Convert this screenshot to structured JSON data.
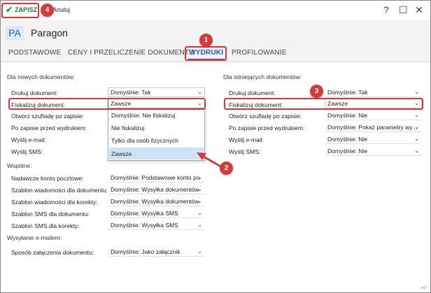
{
  "toolbar": {
    "save_label": "ZAPISZ",
    "cancel_label": "Anuluj"
  },
  "window_controls": {
    "help": "?",
    "maximize": "☐",
    "close": "✕"
  },
  "header": {
    "badge": "PA",
    "title": "Paragon"
  },
  "tabs": [
    {
      "label": "PODSTAWOWE"
    },
    {
      "label": "CENY I PRZELICZENIE DOKUMENTU"
    },
    {
      "label": "WYDRUKI"
    },
    {
      "label": "PROFILOWANIE"
    }
  ],
  "new_docs": {
    "heading": "Dla nowych dokumentów:",
    "rows": [
      {
        "label": "Drukuj dokument:",
        "value": "Domyślnie: Tak"
      },
      {
        "label": "Fiskalizuj dokument:",
        "value": "Zawsze"
      },
      {
        "label": "Otwórz szufladę po zapisie:",
        "value": ""
      },
      {
        "label": "Po zapisie przed wydrukiem:",
        "value": ""
      },
      {
        "label": "Wyślij e-mail:",
        "value": ""
      },
      {
        "label": "Wyślij SMS:",
        "value": ""
      }
    ],
    "dropdown_options": [
      "Domyślnie: Nie fiskalizuj",
      "Nie fiskalizuj",
      "Tylko dla osób fizycznych",
      "Zawsze"
    ]
  },
  "existing_docs": {
    "heading": "Dla istniejących dokumentów:",
    "rows": [
      {
        "label": "Drukuj dokument:",
        "value": "Domyślnie: Tak"
      },
      {
        "label": "Fiskalizuj dokument:",
        "value": "Zawsze"
      },
      {
        "label": "Otwórz szufladę po zapisie:",
        "value": "Domyślnie: Nie"
      },
      {
        "label": "Po zapisie przed wydrukiem:",
        "value": "Domyślnie: Pokaż parametry wy..."
      },
      {
        "label": "Wyślij e-mail:",
        "value": "Domyślnie: Nie"
      },
      {
        "label": "Wyślij SMS:",
        "value": "Domyślnie: Nie"
      }
    ]
  },
  "common": {
    "heading": "Wspólne:",
    "rows": [
      {
        "label": "Nadawcze konto pocztowe:",
        "value": "Domyślnie: Podstawowe konto po"
      },
      {
        "label": "Szablon wiadomości dla dokumentu:",
        "value": "Domyślnie: Wysyłka dokumentów"
      },
      {
        "label": "Szablon wiadomości dla korekty:",
        "value": "Domyślnie: Wysyłka dokumentów"
      },
      {
        "label": "Szablon SMS dla dokumentu:",
        "value": "Domyślnie: Wysyłka SMS"
      },
      {
        "label": "Szablon SMS dla korekty:",
        "value": "Domyślnie: Wysyłka SMS"
      }
    ]
  },
  "email_send": {
    "heading": "Wysyłanie e-mailem:",
    "rows": [
      {
        "label": "Sposób załączenia dokumentu:",
        "value": "Domyślnie: Jako załącznik"
      }
    ]
  },
  "callouts": [
    "1",
    "2",
    "3",
    "4"
  ],
  "resize_hint": "+/-",
  "colors": {
    "accent": "#1d5fa8",
    "callout": "#d63a3a",
    "save_green": "#2e9b2e",
    "dropdown_highlight": "#cde3f5"
  }
}
